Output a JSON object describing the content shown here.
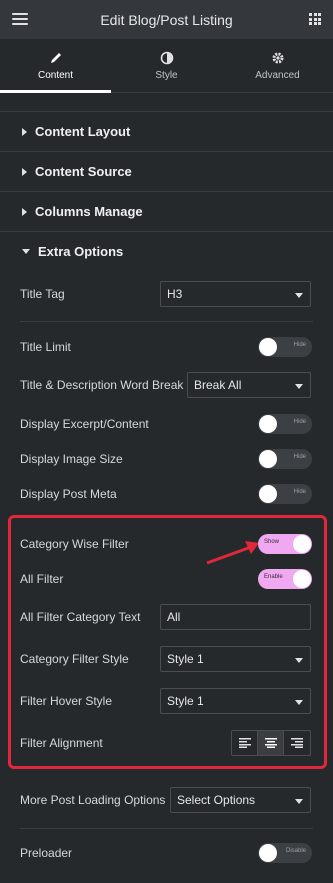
{
  "header": {
    "title": "Edit Blog/Post Listing",
    "menu_icon": "hamburger-icon",
    "apps_icon": "grid-icon"
  },
  "tabs": [
    {
      "label": "Content",
      "icon": "pencil-icon",
      "active": true
    },
    {
      "label": "Style",
      "icon": "contrast-icon",
      "active": false
    },
    {
      "label": "Advanced",
      "icon": "gear-icon",
      "active": false
    }
  ],
  "sections": {
    "content_layout": "Content Layout",
    "content_source": "Content Source",
    "columns_manage": "Columns Manage",
    "extra_options": "Extra Options"
  },
  "fields": {
    "title_tag": {
      "label": "Title Tag",
      "value": "H3"
    },
    "title_limit": {
      "label": "Title Limit",
      "toggle": "Hide"
    },
    "word_break": {
      "label": "Title & Description Word Break",
      "value": "Break All"
    },
    "display_excerpt": {
      "label": "Display Excerpt/Content",
      "toggle": "Hide"
    },
    "display_image_size": {
      "label": "Display Image Size",
      "toggle": "Hide"
    },
    "display_post_meta": {
      "label": "Display Post Meta",
      "toggle": "Hide"
    },
    "category_wise_filter": {
      "label": "Category Wise Filter",
      "toggle": "Show"
    },
    "all_filter": {
      "label": "All Filter",
      "toggle": "Enable"
    },
    "all_filter_text": {
      "label": "All Filter Category Text",
      "value": "All"
    },
    "category_filter_style": {
      "label": "Category Filter Style",
      "value": "Style 1"
    },
    "filter_hover_style": {
      "label": "Filter Hover Style",
      "value": "Style 1"
    },
    "filter_alignment": {
      "label": "Filter Alignment",
      "options": [
        "align-left-icon",
        "align-center-icon",
        "align-right-icon"
      ],
      "selected": 1
    },
    "more_post_loading": {
      "label": "More Post Loading Options",
      "value": "Select Options"
    },
    "preloader": {
      "label": "Preloader",
      "toggle": "Disable"
    }
  },
  "colors": {
    "highlight": "#e0283a",
    "toggle_on": "#f0a9f0",
    "arrow": "#e0283a"
  }
}
